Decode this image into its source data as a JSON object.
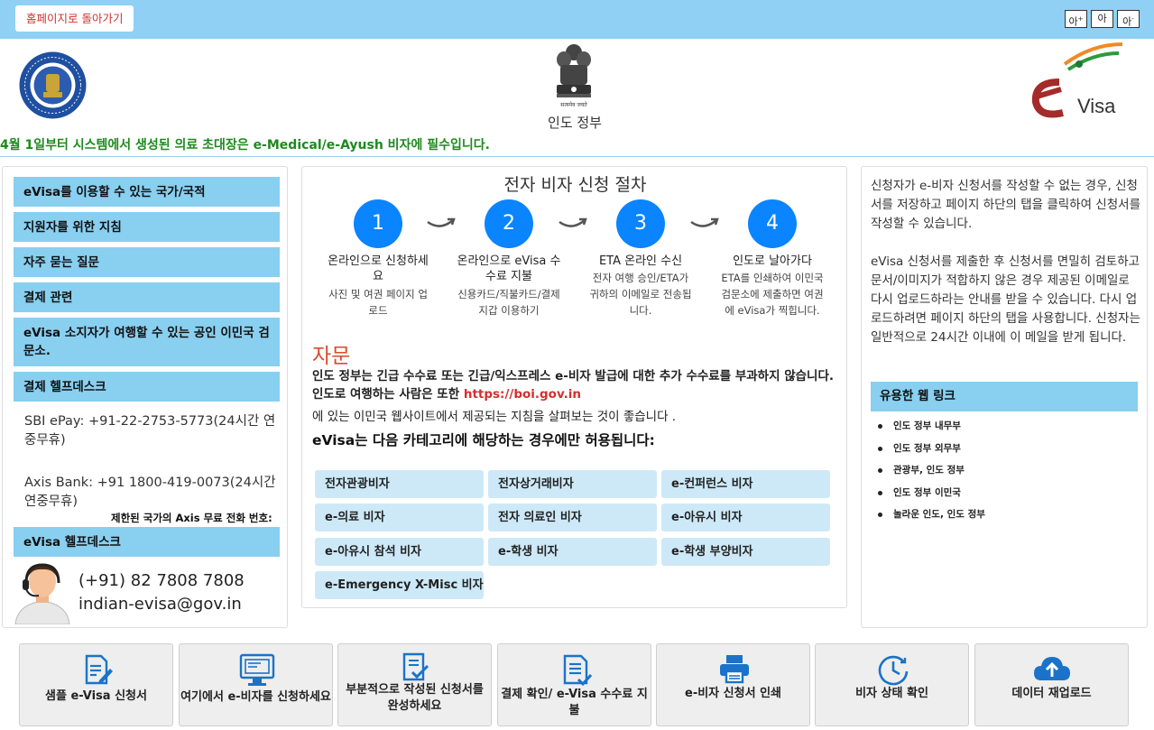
{
  "topbar": {
    "home_button": "홈페이지로 돌아가기",
    "font_increase": "아",
    "font_increase_mark": "+",
    "font_normal": "아",
    "font_decrease": "아",
    "font_decrease_mark": "-"
  },
  "header": {
    "government_name": "인도 정부",
    "emblem_caption": "सत्यमेव जयते",
    "notice": "4월 1일부터 시스템에서 생성된 의료 초대장은 e-Medical/e-Ayush 비자에 필수입니다.",
    "logo_text": "Visa"
  },
  "left_panel": {
    "nav": [
      "eVisa를 이용할 수 있는 국가/국적",
      "지원자를 위한 지침",
      "자주 묻는 질문",
      "결제 관련",
      "eVisa 소지자가 여행할 수 있는 공인 이민국 검문소.",
      "결제 헬프데스크"
    ],
    "sbi_helpline": "SBI ePay: +91-22-2753-5773(24시간 연중무휴)",
    "axis_helpline": "Axis Bank: +91 1800-419-0073(24시간 연중무휴)",
    "axis_note": "제한된 국가의 Axis 무료 전화 번호:",
    "helpdesk_title": "eVisa 헬프데스크",
    "phone": "(+91) 82 7808 7808",
    "email": "indian-evisa@gov.in"
  },
  "middle_panel": {
    "title": "전자 비자 신청 절차",
    "steps": [
      {
        "number": "1",
        "title": "온라인으로 신청하세요",
        "desc": "사진 및 여권 페이지 업로드"
      },
      {
        "number": "2",
        "title": "온라인으로 eVisa 수수료 지불",
        "desc": "신용카드/직불카드/결제지갑 이용하기"
      },
      {
        "number": "3",
        "title": "ETA 온라인 수신",
        "desc": "전자 여행 승인/ETA가 귀하의 이메일로 전송됩니다."
      },
      {
        "number": "4",
        "title": "인도로 날아가다",
        "desc": "ETA를 인쇄하여 이민국 검문소에 제출하면 여권에 eVisa가 찍힙니다."
      }
    ],
    "advisory_title": "자문",
    "advisory_text": "인도 정부는 긴급 수수료 또는 긴급/익스프레스 e-비자 발급에 대한 추가 수수료를 부과하지 않습니다. 인도로 여행하는 사람은 또한",
    "advisory_link": "https://boi.gov.in",
    "advisory_text2": "에 있는 이민국 웹사이트에서 제공되는 지침을 살펴보는 것이 좋습니다 .",
    "categories_title": "eVisa는 다음 카테고리에 해당하는 경우에만 허용됩니다:",
    "categories": [
      "전자관광비자",
      "전자상거래비자",
      "e-컨퍼런스 비자",
      "e-의료 비자",
      "전자 의료인 비자",
      "e-아유시 비자",
      "e-아유시 참석 비자",
      "e-학생 비자",
      "e-학생 부양비자",
      "e-Emergency X-Misc 비자"
    ]
  },
  "right_panel": {
    "text1": "신청자가 e-비자 신청서를 작성할 수 없는 경우, 신청서를 저장하고 페이지 하단의 탭을 클릭하여 신청서를 작성할 수 있습니다.",
    "text2": "eVisa 신청서를 제출한 후 신청서를 면밀히 검토하고 문서/이미지가 적합하지 않은 경우 제공된 이메일로 다시 업로드하라는 안내를 받을 수 있습니다. 다시 업로드하려면 페이지 하단의 탭을 사용합니다. 신청자는 일반적으로 24시간 이내에 이 메일을 받게 됩니다.",
    "links_title": "유용한 웹 링크",
    "links": [
      "인도 정부 내무부",
      "인도 정부 외무부",
      "관광부, 인도 정부",
      "인도 정부 이민국",
      "놀라운 인도, 인도 정부"
    ]
  },
  "bottom_tiles": [
    {
      "label": "샘플 e-Visa 신청서",
      "icon": "document-edit-icon"
    },
    {
      "label": "여기에서 e-비자를 신청하세요",
      "icon": "monitor-form-icon"
    },
    {
      "label": "부분적으로 작성된 신청서를 완성하세요",
      "icon": "checklist-icon"
    },
    {
      "label": "결제 확인/ e-Visa 수수료 지불",
      "icon": "document-check-icon"
    },
    {
      "label": "e-비자 신청서 인쇄",
      "icon": "printer-icon"
    },
    {
      "label": "비자 상태 확인",
      "icon": "clock-icon"
    },
    {
      "label": "데이터 재업로드",
      "icon": "cloud-upload-icon"
    }
  ],
  "colors": {
    "accent_blue": "#0a84ff",
    "nav_blue": "#89cff0",
    "notice_green": "#1d8a1d",
    "advisory_red": "#d94b2b"
  }
}
